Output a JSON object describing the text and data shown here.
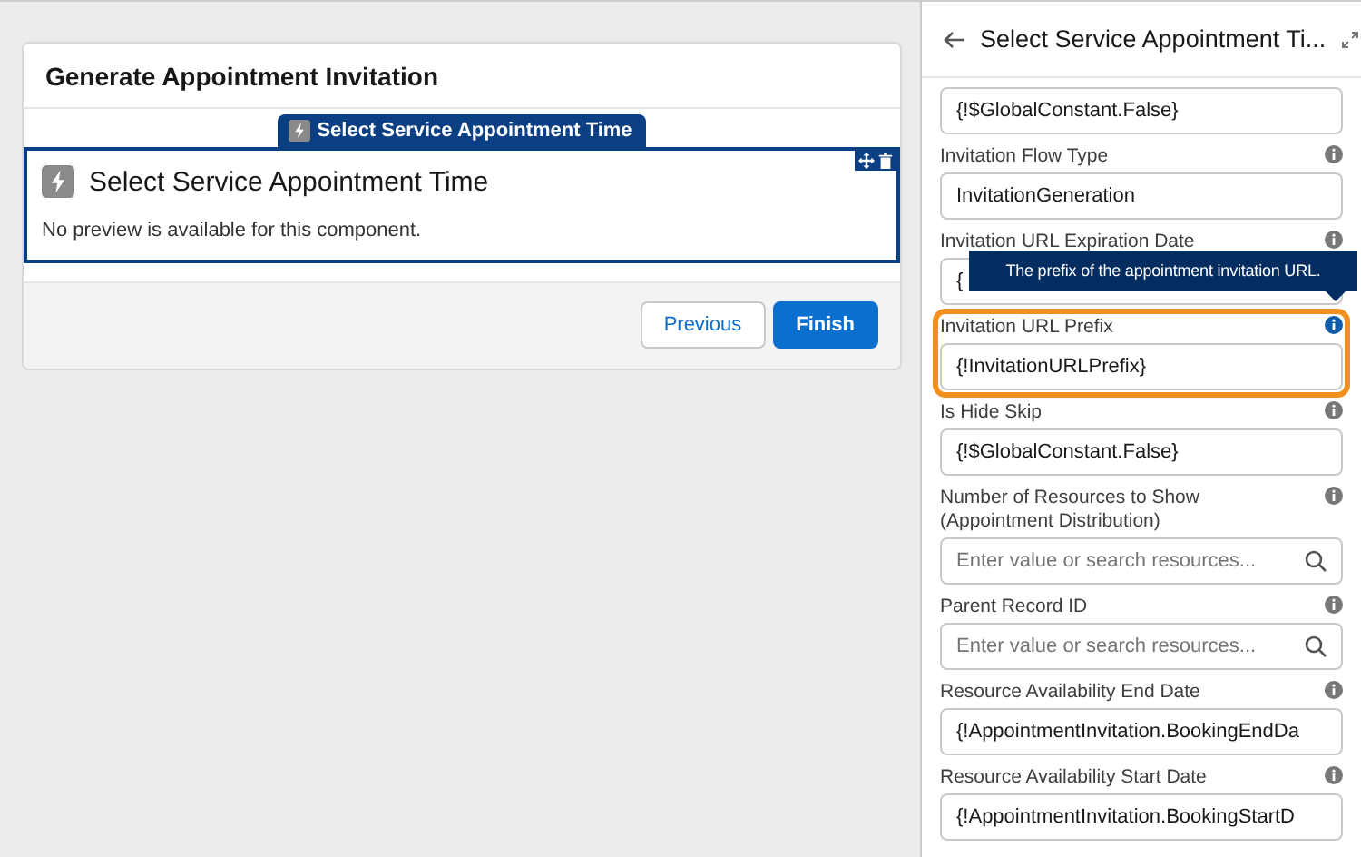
{
  "canvas": {
    "screen_title": "Generate Appointment Invitation",
    "component": {
      "tab_label": "Select Service Appointment Time",
      "title": "Select Service Appointment Time",
      "message": "No preview is available for this component.",
      "selected": true
    },
    "buttons": [
      {
        "label": "Previous",
        "kind": "neutral"
      },
      {
        "label": "Finish",
        "kind": "brand"
      }
    ]
  },
  "panel": {
    "title": "Select Service Appointment Ti...",
    "tooltip": "The prefix of the appointment invitation URL.",
    "fields": [
      {
        "kind": "value",
        "value": "{!$GlobalConstant.False}",
        "focused": false
      },
      {
        "kind": "value",
        "label": "Invitation Flow Type",
        "value": "InvitationGeneration",
        "focused": false
      },
      {
        "kind": "value",
        "label": "Invitation URL Expiration Date",
        "value": "{",
        "focused": false
      },
      {
        "kind": "value",
        "label": "Invitation URL Prefix",
        "value": "{!InvitationURLPrefix}",
        "focused": true
      },
      {
        "kind": "value",
        "label": "Is Hide Skip",
        "value": "{!$GlobalConstant.False}",
        "focused": false
      },
      {
        "kind": "search",
        "label": "Number of Resources to Show (Appointment Distribution)",
        "placeholder": "Enter value or search resources...",
        "focused": false
      },
      {
        "kind": "search",
        "label": "Parent Record ID",
        "placeholder": "Enter value or search resources...",
        "focused": false
      },
      {
        "kind": "value",
        "label": "Resource Availability End Date",
        "value": "{!AppointmentInvitation.BookingEndDa",
        "focused": false
      },
      {
        "kind": "value",
        "label": "Resource Availability Start Date",
        "value": "{!AppointmentInvitation.BookingStartD",
        "focused": false
      }
    ]
  }
}
